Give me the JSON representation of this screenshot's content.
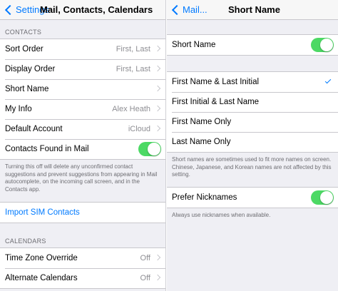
{
  "left": {
    "back_label": "Settings",
    "title": "Mail, Contacts, Calendars",
    "contacts_header": "CONTACTS",
    "contacts_rows": [
      {
        "label": "Sort Order",
        "value": "First, Last"
      },
      {
        "label": "Display Order",
        "value": "First, Last"
      },
      {
        "label": "Short Name",
        "value": ""
      },
      {
        "label": "My Info",
        "value": "Alex Heath"
      },
      {
        "label": "Default Account",
        "value": "iCloud"
      }
    ],
    "contacts_found_label": "Contacts Found in Mail",
    "contacts_found_on": true,
    "contacts_found_footnote": "Turning this off will delete any unconfirmed contact suggestions and prevent suggestions from appearing in Mail autocomplete, on the incoming call screen, and in the Contacts app.",
    "import_sim_label": "Import SIM Contacts",
    "calendars_header": "CALENDARS",
    "calendar_rows": [
      {
        "label": "Time Zone Override",
        "value": "Off"
      },
      {
        "label": "Alternate Calendars",
        "value": "Off"
      }
    ]
  },
  "right": {
    "back_label": "Mail...",
    "title": "Short Name",
    "short_name_label": "Short Name",
    "short_name_on": true,
    "options": [
      {
        "label": "First Name & Last Initial",
        "selected": true
      },
      {
        "label": "First Initial & Last Name",
        "selected": false
      },
      {
        "label": "First Name Only",
        "selected": false
      },
      {
        "label": "Last Name Only",
        "selected": false
      }
    ],
    "options_footnote": "Short names are sometimes used to fit more names on screen. Chinese, Japanese, and Korean names are not affected by this setting.",
    "prefer_nicknames_label": "Prefer Nicknames",
    "prefer_nicknames_on": true,
    "prefer_nicknames_footnote": "Always use nicknames when available."
  },
  "colors": {
    "accent": "#007aff",
    "toggle_on": "#4cd964",
    "background": "#efeff4"
  }
}
